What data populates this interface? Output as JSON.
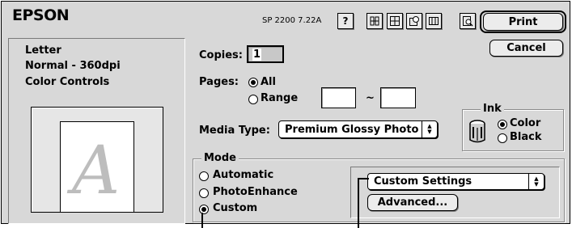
{
  "header": {
    "brand": "EPSON",
    "model": "SP 2200 7.22A"
  },
  "toolbar": {
    "icons": [
      "help-icon",
      "utility-icon",
      "layout-icon",
      "background-icon",
      "custom-icon",
      "preview-icon"
    ]
  },
  "actions": {
    "print_label": "Print",
    "cancel_label": "Cancel"
  },
  "summary": {
    "paper": "Letter",
    "quality": "Normal - 360dpi",
    "color": "Color Controls",
    "preview_letter": "A"
  },
  "copies": {
    "label": "Copies:",
    "value": "1"
  },
  "pages": {
    "label": "Pages:",
    "all_label": "All",
    "range_label": "Range",
    "range_from": "",
    "range_sep": "~",
    "range_to": ""
  },
  "ink": {
    "title": "Ink",
    "color_label": "Color",
    "black_label": "Black",
    "selected": "Color"
  },
  "media": {
    "label": "Media Type:",
    "value": "Premium Glossy Photo"
  },
  "mode": {
    "title": "Mode",
    "options": [
      "Automatic",
      "PhotoEnhance",
      "Custom"
    ],
    "selected": "Custom"
  },
  "custom": {
    "settings_value": "Custom Settings",
    "advanced_label": "Advanced..."
  }
}
